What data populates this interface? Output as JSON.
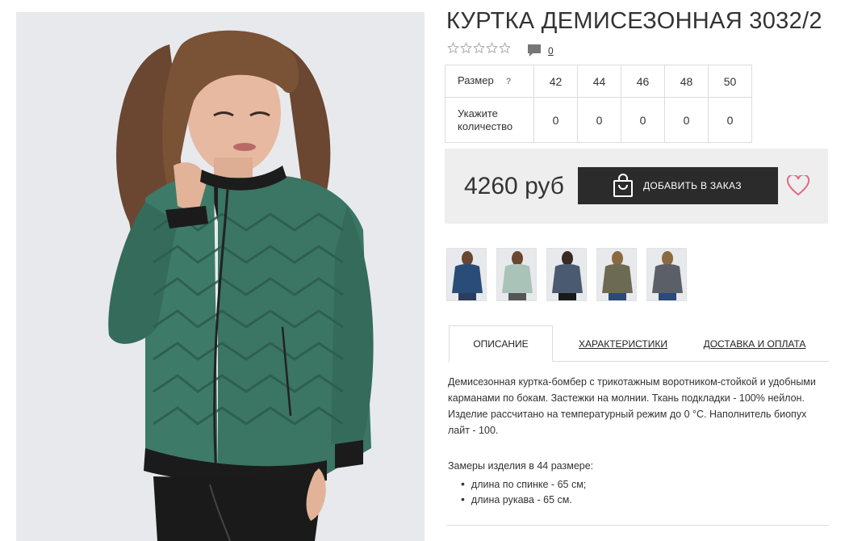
{
  "product": {
    "title": "КУРТКА ДЕМИСЕЗОННАЯ 3032/2",
    "rating_stars": 0,
    "rating_max": 5,
    "comments_count": "0"
  },
  "sizes": {
    "size_label": "Размер",
    "help_label": "?",
    "qty_label": "Укажите количество",
    "options": [
      {
        "size": "42",
        "qty": "0"
      },
      {
        "size": "44",
        "qty": "0"
      },
      {
        "size": "46",
        "qty": "0"
      },
      {
        "size": "48",
        "qty": "0"
      },
      {
        "size": "50",
        "qty": "0"
      }
    ]
  },
  "buy": {
    "price": "4260 руб",
    "add_label": "ДОБАВИТЬ В ЗАКАЗ"
  },
  "thumbnails": [
    {
      "icon": "jacket-navy",
      "color": "#2a4c78"
    },
    {
      "icon": "jacket-mint",
      "color": "#a9c3b8"
    },
    {
      "icon": "jacket-steel",
      "color": "#4a5a70"
    },
    {
      "icon": "jacket-olive",
      "color": "#6c6a52"
    },
    {
      "icon": "jacket-grey",
      "color": "#5b6068"
    }
  ],
  "tabs": {
    "description": "ОПИСАНИЕ",
    "characteristics": "ХАРАКТЕРИСТИКИ",
    "delivery": "ДОСТАВКА И ОПЛАТА",
    "active": "description"
  },
  "description": {
    "text": "Демисезонная куртка-бомбер с трикотажным воротником-стойкой и удобными карманами по бокам. Застежки на молнии. Ткань подкладки - 100% нейлон. Изделие рассчитано на температурный режим до 0 °С. Наполнитель биопух лайт - 100.",
    "measures_title": "Замеры изделия в 44 размере:",
    "measures": [
      "длина по спинке - 65 см;",
      "длина рукава - 65 см."
    ]
  },
  "colors": {
    "jacket": "#3e7a68",
    "button": "#2b2b2b",
    "heart": "#e06a7f",
    "buybox": "#eeeeee"
  }
}
